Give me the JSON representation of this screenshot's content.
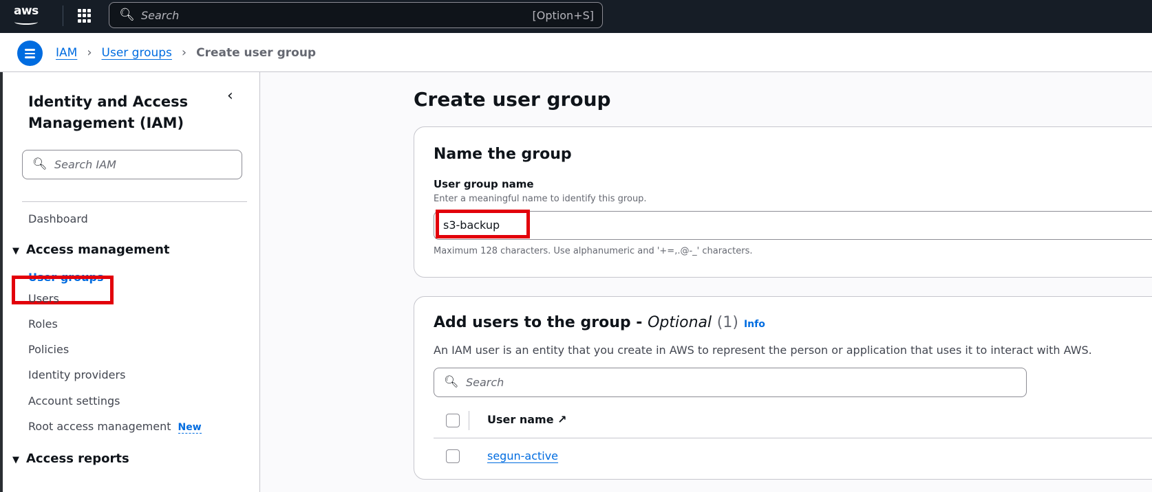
{
  "topbar": {
    "logo": "aws",
    "search_placeholder": "Search",
    "search_shortcut": "[Option+S]"
  },
  "breadcrumb": {
    "items": [
      "IAM",
      "User groups"
    ],
    "current": "Create user group"
  },
  "sidebar": {
    "title": "Identity and Access Management (IAM)",
    "search_placeholder": "Search IAM",
    "dashboard": "Dashboard",
    "section_access_management": "Access management",
    "items": [
      "User groups",
      "Users",
      "Roles",
      "Policies",
      "Identity providers",
      "Account settings",
      "Root access management"
    ],
    "new_badge": "New",
    "section_access_reports": "Access reports"
  },
  "main": {
    "title": "Create user group",
    "name_card": {
      "heading": "Name the group",
      "label": "User group name",
      "description": "Enter a meaningful name to identify this group.",
      "value": "s3-backup",
      "constraint": "Maximum 128 characters. Use alphanumeric and '+=,.@-_' characters."
    },
    "users_card": {
      "heading": "Add users to the group - ",
      "optional": "Optional",
      "count": "(1)",
      "info": "Info",
      "description": "An IAM user is an entity that you create in AWS to represent the person or application that uses it to interact with AWS.",
      "search_placeholder": "Search",
      "column_header": "User name",
      "rows": [
        "segun-active"
      ]
    }
  },
  "colors": {
    "link": "#006ce0",
    "highlight": "#e2000b",
    "topbar": "#161d26"
  }
}
